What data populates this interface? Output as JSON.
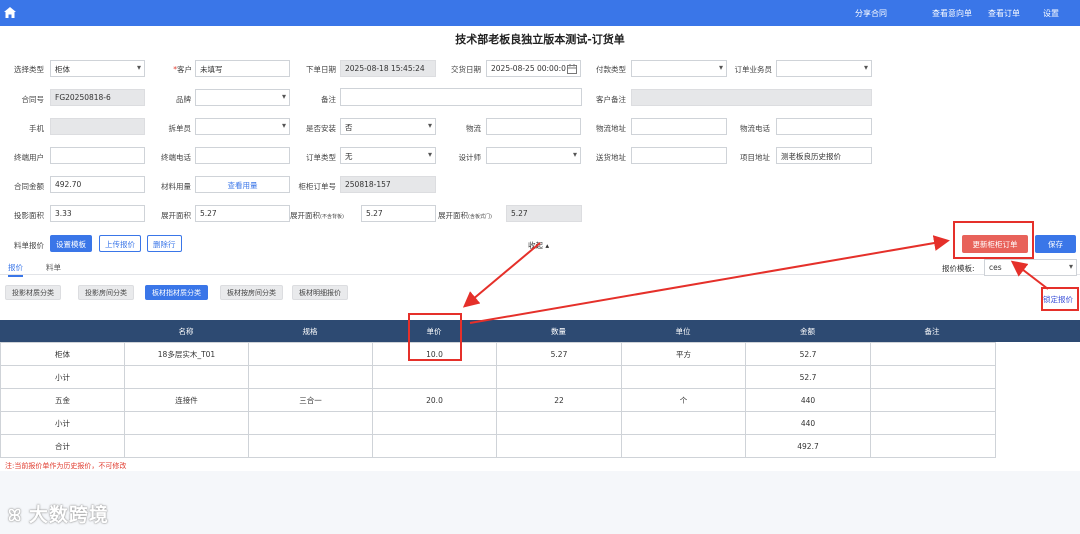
{
  "nav": {
    "links": [
      "分享合同",
      "查看意向单",
      "查看订单",
      "设置"
    ]
  },
  "page_title": "技术部老板良独立版本测试-订货单",
  "form": {
    "select_type_label": "选择类型",
    "select_type_value": "柜体",
    "customer_label": "客户",
    "customer_required": "*",
    "customer_value": "未填写",
    "order_date_label": "下单日期",
    "order_date_value": "2025-08-18 15:45:24",
    "delivery_date_label": "交货日期",
    "delivery_date_value": "2025-08-25 00:00:0",
    "payment_type_label": "付款类型",
    "payment_type_value": "",
    "salesperson_label": "订单业务员",
    "salesperson_value": "",
    "contract_no_label": "合同号",
    "contract_no_value": "FG20250818-6",
    "brand_label": "品牌",
    "brand_value": "",
    "remark_label": "备注",
    "remark_value": "",
    "customer_remark_label": "客户备注",
    "customer_remark_value": "",
    "phone_label": "手机",
    "phone_value": "",
    "splitter_label": "拆单员",
    "splitter_value": "",
    "install_label": "是否安装",
    "install_value": "否",
    "logistics_label": "物流",
    "logistics_value": "",
    "logistics_addr_label": "物流地址",
    "logistics_addr_value": "",
    "logistics_phone_label": "物流电话",
    "logistics_phone_value": "",
    "end_user_label": "终端用户",
    "end_user_value": "",
    "end_phone_label": "终端电话",
    "end_phone_value": "",
    "order_type_label": "订单类型",
    "order_type_value": "无",
    "designer_label": "设计师",
    "designer_value": "",
    "delivery_addr_label": "送货地址",
    "delivery_addr_value": "",
    "project_addr_label": "项目地址",
    "project_addr_value": "测老板良历史报价",
    "contract_amount_label": "合同金额",
    "contract_amount_value": "492.70",
    "material_label": "材料用量",
    "material_link": "查看用量",
    "cabinet_order_label": "柜柜订单号",
    "cabinet_order_value": "250818-157",
    "proj_area_label": "投影面积",
    "proj_area_value": "3.33",
    "unfold_area_label": "展开面积",
    "unfold_area_value": "5.27",
    "unfold_area2_label": "展开面积",
    "unfold_area2_sub": "(不含背板)",
    "unfold_area2_value": "5.27",
    "unfold_area3_label": "展开面积",
    "unfold_area3_sub": "(含板式门)",
    "unfold_area3_value": "5.27"
  },
  "quote_bar": {
    "label": "料单报价",
    "set_template": "设置模板",
    "upload_quote": "上传报价",
    "delete_row": "删除行",
    "collapse": "收起 ▴",
    "update_cabinet_order": "更新柜柜订单",
    "save": "保存"
  },
  "tabs": {
    "items": [
      "报价",
      "料单"
    ],
    "quote_template_label": "报价模板:",
    "quote_template_value": "ces",
    "lock_quote": "锁定报价"
  },
  "category_tabs": [
    "投影材质分类",
    "投影房间分类",
    "板材指材质分类",
    "板材按房间分类",
    "板材明细报价"
  ],
  "table": {
    "headers": [
      "名称",
      "规格",
      "单价",
      "数量",
      "单位",
      "金额",
      "备注"
    ],
    "rows": [
      [
        "柜体",
        "18多层实木_T01",
        "",
        "10.0",
        "5.27",
        "平方",
        "52.7",
        ""
      ],
      [
        "小计",
        "",
        "",
        "",
        "",
        "",
        "52.7",
        ""
      ],
      [
        "五金",
        "连接件",
        "三合一",
        "20.0",
        "22",
        "个",
        "440",
        ""
      ],
      [
        "小计",
        "",
        "",
        "",
        "",
        "",
        "440",
        ""
      ],
      [
        "合计",
        "",
        "",
        "",
        "",
        "",
        "492.7",
        ""
      ]
    ]
  },
  "note": "注:当前报价单作为历史报价，不可修改",
  "watermark": "大数跨境",
  "colors": {
    "primary": "#3a76e8",
    "header_dark": "#2d4a72",
    "highlight_red": "#e5302a",
    "update_button": "#e8625a"
  }
}
